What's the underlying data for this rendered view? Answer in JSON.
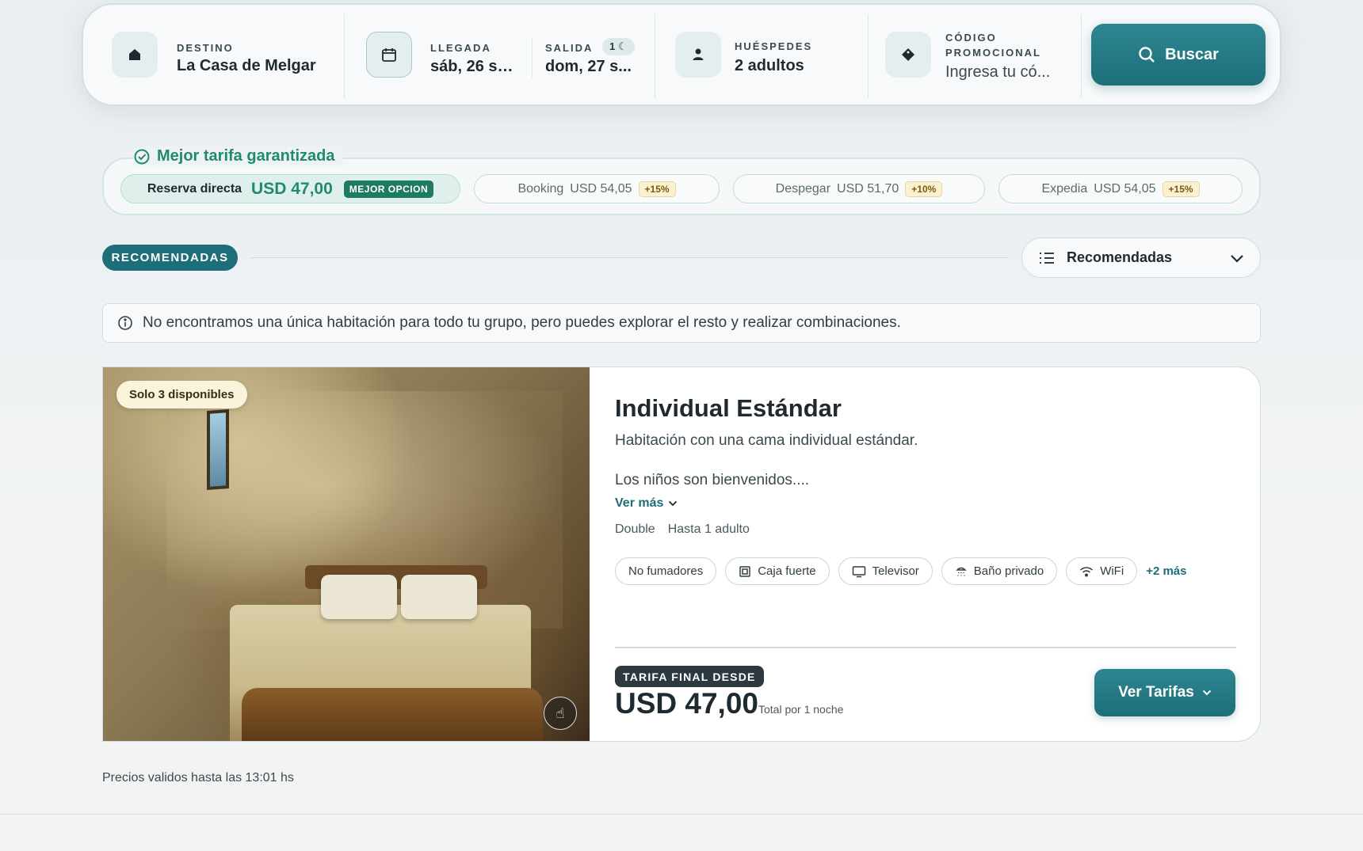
{
  "search": {
    "destination": {
      "label": "DESTINO",
      "value": "La Casa de Melgar",
      "icon": "home-icon"
    },
    "arrival": {
      "label": "LLEGADA",
      "value": "sáb, 26 se...",
      "icon": "calendar-icon"
    },
    "departure": {
      "label": "SALIDA",
      "value": "dom, 27 s...",
      "nights": "1"
    },
    "guests": {
      "label": "HUÉSPEDES",
      "value": "2 adultos",
      "icon": "person-icon"
    },
    "promo": {
      "label_line1": "CÓDIGO",
      "label_line2": "PROMOCIONAL",
      "placeholder": "Ingresa tu có...",
      "icon": "tag-icon"
    },
    "button_label": "Buscar"
  },
  "best_rate": {
    "title": "Mejor tarifa garantizada",
    "direct": {
      "label": "Reserva directa",
      "price": "USD 47,00",
      "badge": "MEJOR OPCION"
    },
    "competitors": [
      {
        "name": "Booking",
        "price": "USD 54,05",
        "diff": "+15%"
      },
      {
        "name": "Despegar",
        "price": "USD 51,70",
        "diff": "+10%"
      },
      {
        "name": "Expedia",
        "price": "USD 54,05",
        "diff": "+15%"
      }
    ]
  },
  "section": {
    "badge": "RECOMENDADAS",
    "sort_label": "Recomendadas"
  },
  "info_message": "No encontramos una única habitación para todo tu grupo, pero puedes explorar el resto y realizar combinaciones.",
  "room": {
    "availability": "Solo 3 disponibles",
    "title": "Individual Estándar",
    "description": "Habitación con una cama individual estándar.",
    "note": "Los niños son bienvenidos....",
    "see_more": "Ver más",
    "bed_type": "Double",
    "capacity": "Hasta 1 adulto",
    "amenities": [
      {
        "label": "No fumadores",
        "icon": ""
      },
      {
        "label": "Caja fuerte",
        "icon": "safe-icon"
      },
      {
        "label": "Televisor",
        "icon": "tv-icon"
      },
      {
        "label": "Baño privado",
        "icon": "shower-icon"
      },
      {
        "label": "WiFi",
        "icon": "wifi-icon"
      }
    ],
    "more_amenities": "+2 más",
    "price_label": "TARIFA FINAL DESDE",
    "price": "USD 47,00",
    "price_note": "Total por 1 noche",
    "rates_button": "Ver Tarifas"
  },
  "validity": "Precios validos hasta las 13:01 hs",
  "colors": {
    "primary": "#1d6e79",
    "accent_green": "#1f8a70",
    "text": "#1e2a2f"
  }
}
